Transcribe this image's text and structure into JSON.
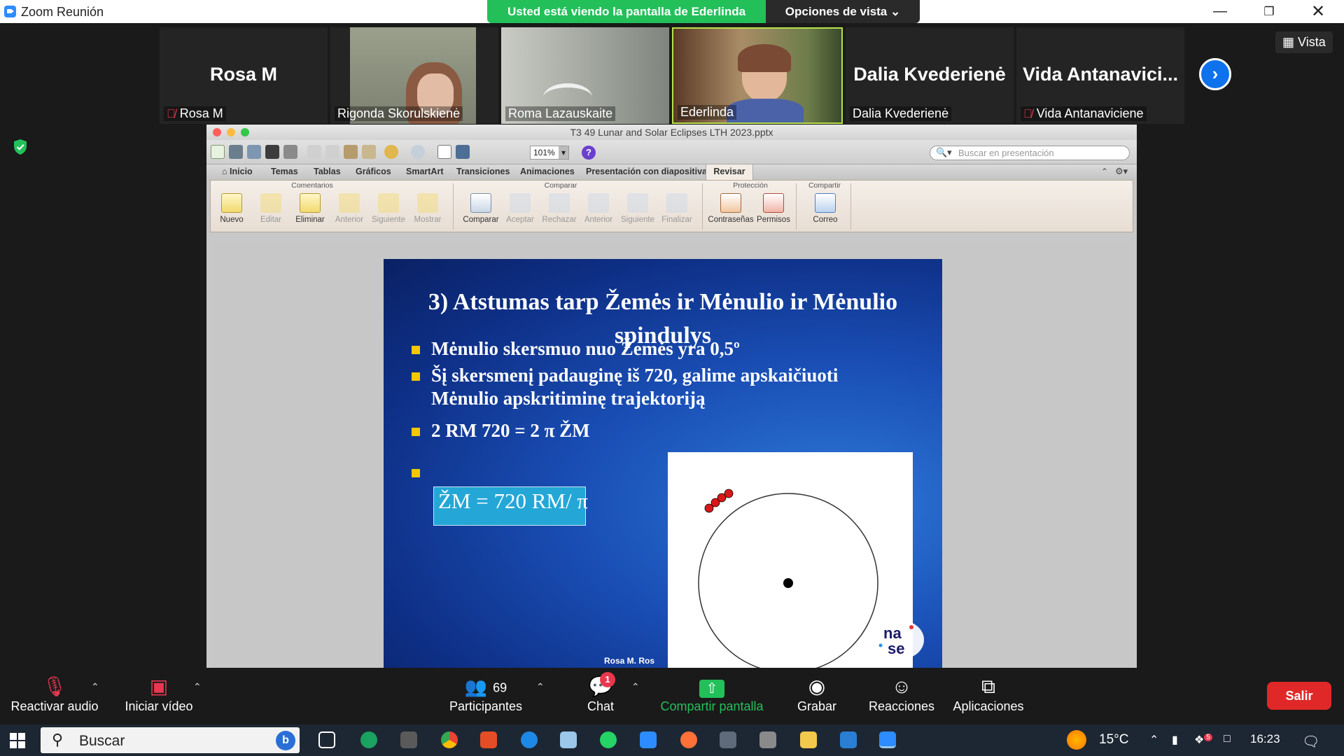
{
  "titlebar": {
    "app_title": "Zoom Reunión",
    "share_banner": "Usted está viendo la pantalla de Ederlinda",
    "view_options": "Opciones de vista ⌄"
  },
  "participants": [
    {
      "big_name": "Rosa M",
      "label": "Rosa M",
      "muted": true
    },
    {
      "label": "Rigonda Skorulskienė",
      "video": true
    },
    {
      "label": "Roma Lazauskaite",
      "video": true
    },
    {
      "label": "Ederlinda",
      "video": true,
      "active_speaker": true
    },
    {
      "big_name": "Dalia Kvederienė",
      "label": "Dalia Kvederienė"
    },
    {
      "big_name": "Vida  Antanavici...",
      "label": "Vida Antanaviciene",
      "muted": true
    }
  ],
  "strip": {
    "vista_label": "Vista"
  },
  "ppt": {
    "filename": "T3 49 Lunar and Solar Eclipses LTH 2023.pptx",
    "zoom": "101%",
    "search_placeholder": "Buscar en presentación",
    "tabs": [
      "Inicio",
      "Temas",
      "Tablas",
      "Gráficos",
      "SmartArt",
      "Transiciones",
      "Animaciones",
      "Presentación con diapositivas",
      "Revisar"
    ],
    "groups": {
      "comentarios": "Comentarios",
      "comparar": "Comparar",
      "proteccion": "Protección",
      "compartir": "Compartir"
    },
    "buttons": {
      "nuevo": "Nuevo",
      "editar": "Editar",
      "eliminar": "Eliminar",
      "anterior": "Anterior",
      "siguiente": "Siguiente",
      "mostrar": "Mostrar",
      "comparar": "Comparar",
      "aceptar": "Aceptar",
      "rechazar": "Rechazar",
      "anterior2": "Anterior",
      "siguiente2": "Siguiente",
      "finalizar": "Finalizar",
      "contrasenas": "Contraseñas",
      "permisos": "Permisos",
      "correo": "Correo"
    }
  },
  "slide": {
    "title_line1": "3) Atstumas tarp Žemės ir Mėnulio ir Mėnulio",
    "title_line2": "spindulys",
    "bullet1": "Mėnulio skersmuo nuo Žemės yra 0,5º",
    "bullet2_line1": "Šį skersmenį padauginę iš 720, galime apskaičiuoti",
    "bullet2_line2": "Mėnulio apskritiminę trajektoriją",
    "bullet3": "2 RM 720 = 2 π ŽM",
    "bullet4": "ŽM = 720 RM/ π",
    "author": "Rosa M. Ros",
    "logo_text": "nase"
  },
  "bottombar": {
    "unmute": "Reactivar audio",
    "start_video": "Iniciar vídeo",
    "participants": "Participantes",
    "participants_count": "69",
    "chat": "Chat",
    "chat_badge": "1",
    "share": "Compartir pantalla",
    "record": "Grabar",
    "reactions": "Reacciones",
    "apps": "Aplicaciones",
    "leave": "Salir"
  },
  "taskbar": {
    "search": "Buscar",
    "temperature": "15°C",
    "time": "16:23",
    "notif_badge": "5"
  },
  "colors": {
    "zoom_green": "#23c05a",
    "zoom_blue": "#0e72ed",
    "leave_red": "#e02828",
    "slide_blue": "#1a4fb6",
    "highlight": "#24a7d6"
  }
}
